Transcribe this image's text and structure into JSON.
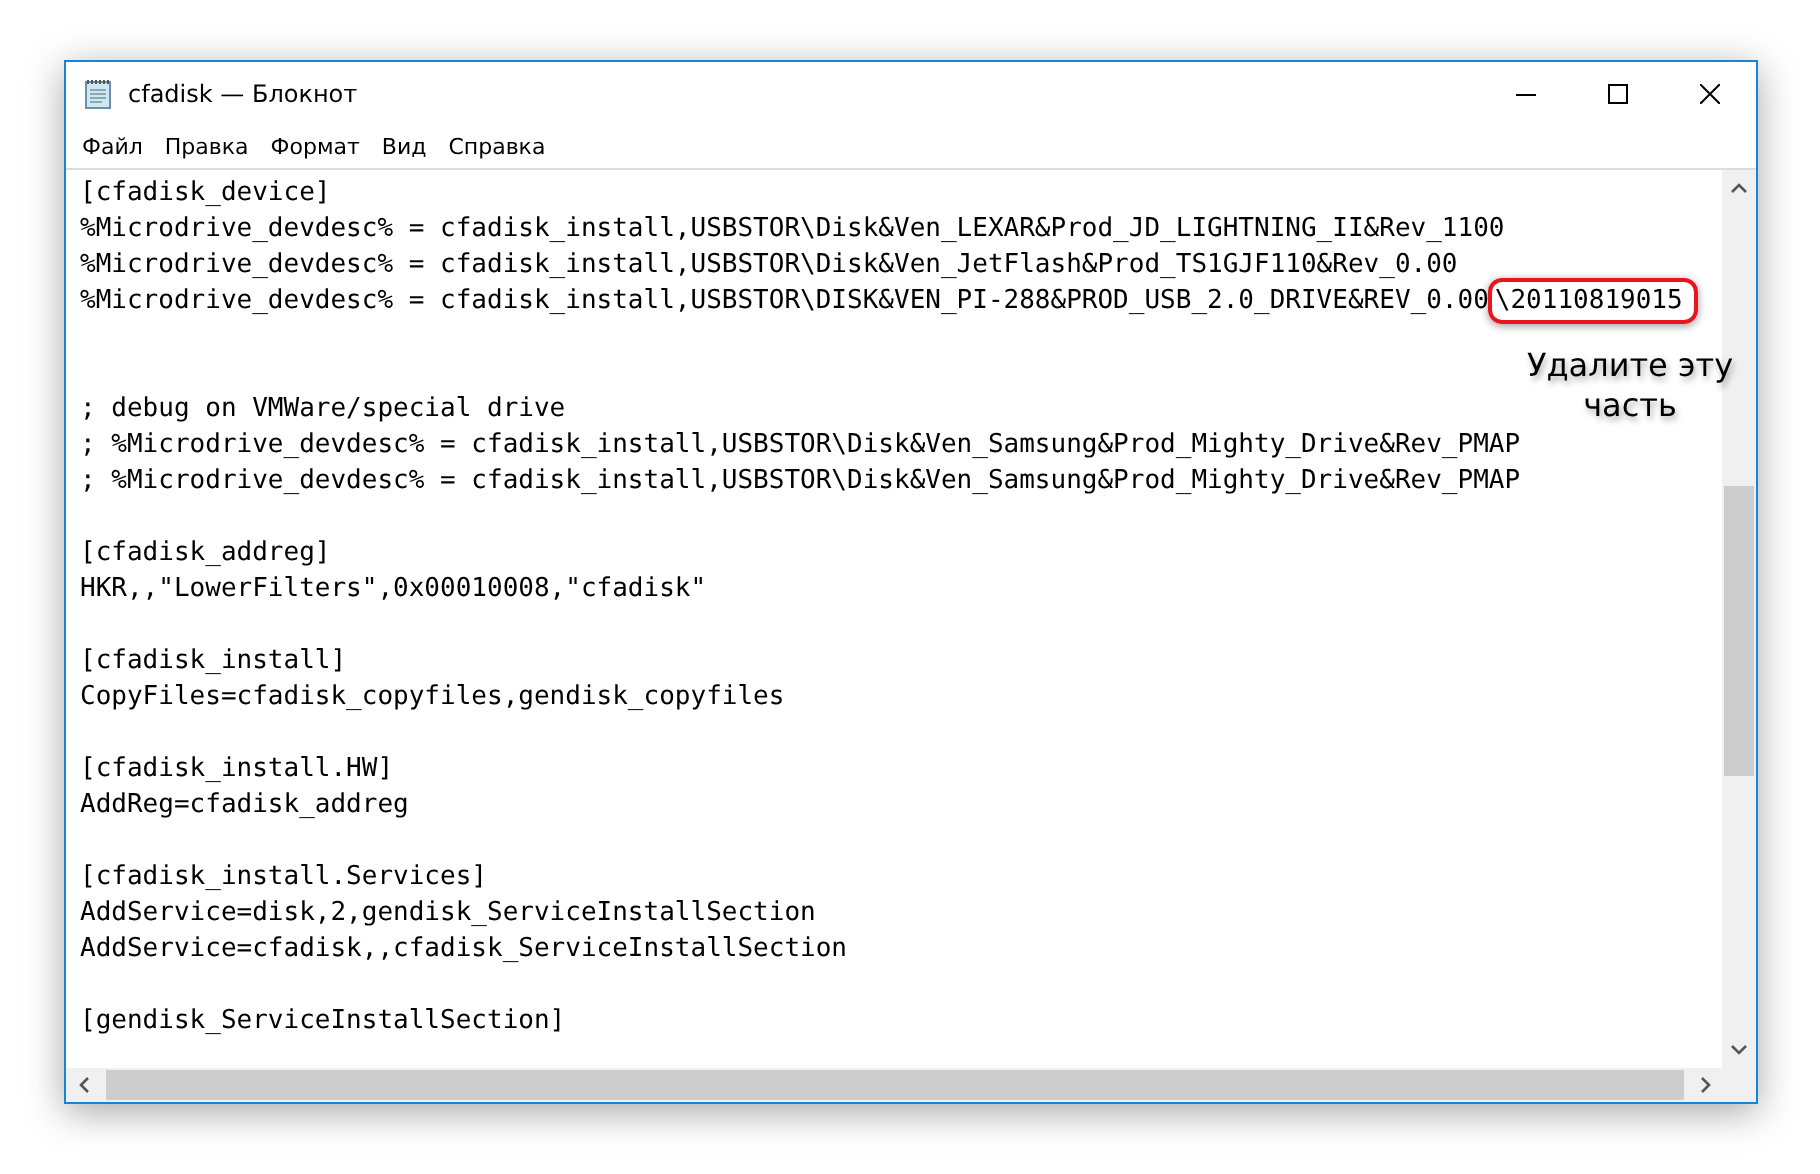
{
  "window": {
    "title": "cfadisk — Блокнот"
  },
  "menu": [
    {
      "label": "Файл"
    },
    {
      "label": "Правка"
    },
    {
      "label": "Формат"
    },
    {
      "label": "Вид"
    },
    {
      "label": "Справка"
    }
  ],
  "lines": [
    {
      "kind": "code",
      "text": "[cfadisk_device]"
    },
    {
      "kind": "code",
      "text": "%Microdrive_devdesc% = cfadisk_install,USBSTOR\\Disk&Ven_LEXAR&Prod_JD_LIGHTNING_II&Rev_1100"
    },
    {
      "kind": "code",
      "text": "%Microdrive_devdesc% = cfadisk_install,USBSTOR\\Disk&Ven_JetFlash&Prod_TS1GJF110&Rev_0.00"
    },
    {
      "kind": "annotated",
      "text": "%Microdrive_devdesc% = cfadisk_install,USBSTOR\\DISK&VEN_PI-288&PROD_USB_2.0_DRIVE&REV_0.00",
      "marked": "\\20110819015",
      "note": "Удалите эту часть"
    },
    {
      "kind": "blank"
    },
    {
      "kind": "blank"
    },
    {
      "kind": "code",
      "text": "; debug on VMWare/special drive"
    },
    {
      "kind": "code",
      "text": "; %Microdrive_devdesc% = cfadisk_install,USBSTOR\\Disk&Ven_Samsung&Prod_Mighty_Drive&Rev_PMAP"
    },
    {
      "kind": "code",
      "text": "; %Microdrive_devdesc% = cfadisk_install,USBSTOR\\Disk&Ven_Samsung&Prod_Mighty_Drive&Rev_PMAP"
    },
    {
      "kind": "blank"
    },
    {
      "kind": "code",
      "text": "[cfadisk_addreg]"
    },
    {
      "kind": "code",
      "text": "HKR,,\"LowerFilters\",0x00010008,\"cfadisk\""
    },
    {
      "kind": "blank"
    },
    {
      "kind": "code",
      "text": "[cfadisk_install]"
    },
    {
      "kind": "code",
      "text": "CopyFiles=cfadisk_copyfiles,gendisk_copyfiles"
    },
    {
      "kind": "blank"
    },
    {
      "kind": "code",
      "text": "[cfadisk_install.HW]"
    },
    {
      "kind": "code",
      "text": "AddReg=cfadisk_addreg"
    },
    {
      "kind": "blank"
    },
    {
      "kind": "code",
      "text": "[cfadisk_install.Services]"
    },
    {
      "kind": "code",
      "text": "AddService=disk,2,gendisk_ServiceInstallSection"
    },
    {
      "kind": "code",
      "text": "AddService=cfadisk,,cfadisk_ServiceInstallSection"
    },
    {
      "kind": "blank"
    },
    {
      "kind": "code",
      "text": "[gendisk_ServiceInstallSection]"
    }
  ]
}
